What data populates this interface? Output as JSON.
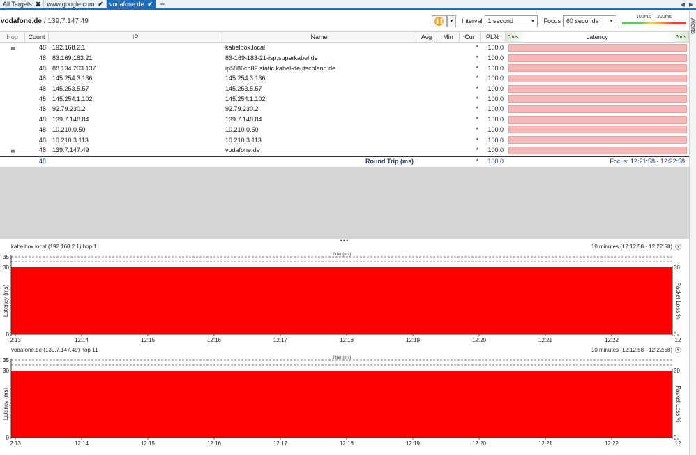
{
  "tabs": [
    {
      "label": "All Targets",
      "icon": "close-icon",
      "symbol": "✖",
      "active": false
    },
    {
      "label": "www.google.com",
      "icon": "check-icon",
      "symbol": "✔",
      "active": false
    },
    {
      "label": "vodafone.de",
      "icon": "check-icon",
      "symbol": "✔",
      "active": true
    }
  ],
  "tab_add": "+",
  "alerts_label": "Alerts",
  "target": {
    "name": "vodafone.de",
    "ip": "/ 139.7.147.49"
  },
  "toolbar": {
    "interval_label": "Interval",
    "interval_value": "1 second",
    "focus_label": "Focus",
    "focus_value": "60 seconds",
    "scale_100": "100ms",
    "scale_200": "200ms"
  },
  "columns": {
    "hop": "Hop",
    "count": "Count",
    "ip": "IP",
    "name": "Name",
    "avg": "Avg",
    "min": "Min",
    "cur": "Cur",
    "pl": "PL%",
    "latency": "Latency",
    "lat_min": "0 ms",
    "lat_max": "0 ms"
  },
  "rows": [
    {
      "icon": true,
      "count": "48",
      "ip": "192.168.2.1",
      "name": "kabelbox.local",
      "cur": "*",
      "pl": "100,0"
    },
    {
      "icon": false,
      "count": "48",
      "ip": "83.169.183.21",
      "name": "83-169-183-21-isp.superkabel.de",
      "cur": "*",
      "pl": "100,0"
    },
    {
      "icon": false,
      "count": "48",
      "ip": "88.134.203.137",
      "name": "ip5886cb89.static.kabel-deutschland.de",
      "cur": "*",
      "pl": "100,0"
    },
    {
      "icon": false,
      "count": "48",
      "ip": "145.254.3.136",
      "name": "145.254.3.136",
      "cur": "*",
      "pl": "100,0"
    },
    {
      "icon": false,
      "count": "48",
      "ip": "145.253.5.57",
      "name": "145.253.5.57",
      "cur": "*",
      "pl": "100,0"
    },
    {
      "icon": false,
      "count": "48",
      "ip": "145.254.1.102",
      "name": "145.254.1.102",
      "cur": "*",
      "pl": "100,0"
    },
    {
      "icon": false,
      "count": "48",
      "ip": "92.79.230.2",
      "name": "92.79.230.2",
      "cur": "*",
      "pl": "100,0"
    },
    {
      "icon": false,
      "count": "48",
      "ip": "139.7.148.84",
      "name": "139.7.148.84",
      "cur": "*",
      "pl": "100,0"
    },
    {
      "icon": false,
      "count": "48",
      "ip": "10.210.0.50",
      "name": "10.210.0.50",
      "cur": "*",
      "pl": "100,0"
    },
    {
      "icon": false,
      "count": "48",
      "ip": "10.210.3.113",
      "name": "10.210.3.113",
      "cur": "*",
      "pl": "100,0"
    },
    {
      "icon": true,
      "count": "48",
      "ip": "139.7.147.49",
      "name": "vodafone.de",
      "cur": "*",
      "pl": "100,0"
    }
  ],
  "summary": {
    "count": "48",
    "name": "Round Trip (ms)",
    "cur": "*",
    "pl": "100,0",
    "focus": "Focus: 12:21:58 - 12:22:58"
  },
  "splitter": "•••",
  "graphs": [
    {
      "title": "kabelbox.local (192.168.2.1) hop 1",
      "range": "10 minutes (12:12:58 - 12:22:58)",
      "jitter_label": "Jitter (ms)",
      "ylabel": "Latency (ms)",
      "y2label": "Packet Loss %",
      "y_ticks": [
        "35",
        "30",
        "0"
      ],
      "y2_ticks": [
        "30",
        "0"
      ],
      "x_ticks": [
        "2:13",
        "12:14",
        "12:15",
        "12:16",
        "12:17",
        "12:18",
        "12:19",
        "12:20",
        "12:21",
        "12:22",
        "12"
      ],
      "packet_loss_percent": 100,
      "loss_color": "#ff0000"
    },
    {
      "title": "vodafone.de (139.7.147.49) hop 11",
      "range": "10 minutes (12:12:58 - 12:22:58)",
      "jitter_label": "Jitter (ms)",
      "ylabel": "Latency (ms)",
      "y2label": "Packet Loss %",
      "y_ticks": [
        "35",
        "30",
        "0"
      ],
      "y2_ticks": [
        "30",
        "0"
      ],
      "x_ticks": [
        "2:13",
        "12:14",
        "12:15",
        "12:16",
        "12:17",
        "12:18",
        "12:19",
        "12:20",
        "12:21",
        "12:22",
        "12"
      ],
      "packet_loss_percent": 100,
      "loss_color": "#ff0000"
    }
  ]
}
